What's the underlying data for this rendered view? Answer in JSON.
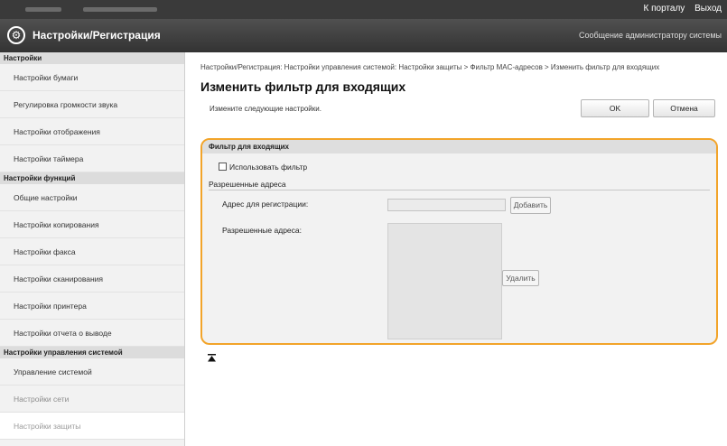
{
  "topbar": {
    "login_link": "К порталу",
    "logout_link": "Выход"
  },
  "header": {
    "title": "Настройки/Регистрация",
    "admin_message": "Сообщение администратору системы"
  },
  "sidebar": {
    "sections": [
      {
        "title": "Настройки",
        "items": [
          "Настройки бумаги",
          "Регулировка громкости звука",
          "Настройки отображения",
          "Настройки таймера"
        ]
      },
      {
        "title": "Настройки функций",
        "items": [
          "Общие настройки",
          "Настройки копирования",
          "Настройки факса",
          "Настройки сканирования",
          "Настройки принтера",
          "Настройки отчета о выводе"
        ]
      },
      {
        "title": "Настройки управления системой",
        "items": [
          "Управление системой",
          "Настройки сети",
          "Настройки защиты"
        ]
      }
    ]
  },
  "main": {
    "breadcrumb": "Настройки/Регистрация: Настройки управления системой: Настройки защиты > Фильтр MAC-адресов > Изменить фильтр для входящих",
    "page_title": "Изменить фильтр для входящих",
    "instruction": "Измените следующие настройки.",
    "ok_label": "OK",
    "cancel_label": "Отмена",
    "panel": {
      "title": "Фильтр для входящих",
      "use_filter_label": "Использовать фильтр",
      "use_filter_checked": false,
      "allowed_section": "Разрешенные адреса",
      "register_label": "Адрес для регистрации:",
      "register_value": "",
      "add_button": "Добавить",
      "allowed_label": "Разрешенные адреса:",
      "allowed_list": [],
      "delete_button": "Удалить"
    },
    "back_to_top_icon": "arrow-top-icon"
  },
  "colors": {
    "accent_border": "#f2a42a",
    "topbar": "#3a3a3a",
    "header": "#404040"
  }
}
